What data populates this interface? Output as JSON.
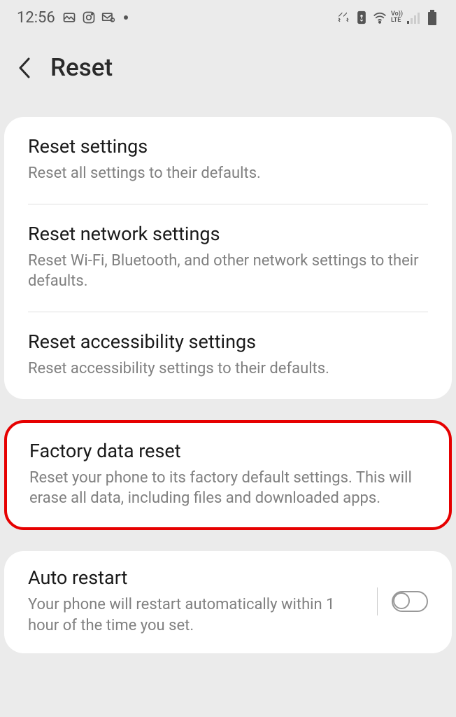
{
  "statusBar": {
    "time": "12:56"
  },
  "header": {
    "title": "Reset"
  },
  "group1": {
    "items": [
      {
        "title": "Reset settings",
        "desc": "Reset all settings to their defaults."
      },
      {
        "title": "Reset network settings",
        "desc": "Reset Wi-Fi, Bluetooth, and other network settings to their defaults."
      },
      {
        "title": "Reset accessibility settings",
        "desc": "Reset accessibility settings to their defaults."
      }
    ]
  },
  "group2": {
    "title": "Factory data reset",
    "desc": "Reset your phone to its factory default settings. This will erase all data, including files and downloaded apps."
  },
  "group3": {
    "title": "Auto restart",
    "desc": "Your phone will restart automatically within 1 hour of the time you set."
  }
}
